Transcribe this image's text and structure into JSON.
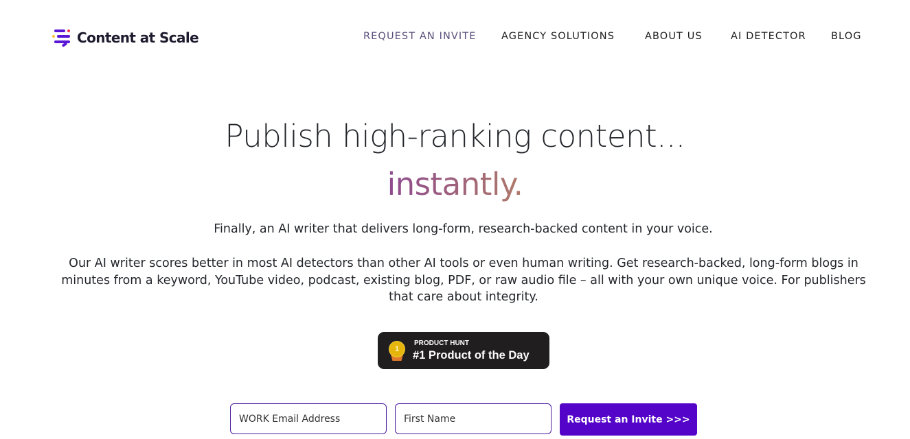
{
  "header": {
    "logo_text": "Content at Scale",
    "nav": [
      {
        "label": "REQUEST AN INVITE",
        "active": true
      },
      {
        "label": "AGENCY SOLUTIONS"
      },
      {
        "label": "ABOUT US"
      },
      {
        "label": "AI DETECTOR"
      },
      {
        "label": "BLOG"
      }
    ]
  },
  "hero": {
    "title": "Publish high-ranking content...",
    "subtitle": "instantly.",
    "lead": "Finally, an AI writer that delivers long-form, research-backed content in your voice.",
    "description_lines": [
      "Our AI writer scores better in most AI detectors than other AI tools or even human writing. Get research-backed, long-form blogs in",
      "minutes from a keyword, YouTube video, podcast, existing blog, PDF, or raw audio file – all with your own unique voice. For publishers",
      "that care about integrity."
    ]
  },
  "badge": {
    "medal_number": "1",
    "small_label": "PRODUCT HUNT",
    "big_label": "#1 Product of the Day"
  },
  "form": {
    "email_placeholder": "WORK Email Address",
    "name_placeholder": "First Name",
    "submit_label": "Request an Invite >>>"
  },
  "colors": {
    "brand_purple": "#5403c9",
    "badge_bg": "#211e20",
    "accent_gradient_start": "#8e4a8f",
    "accent_gradient_end": "#b07a6a"
  }
}
